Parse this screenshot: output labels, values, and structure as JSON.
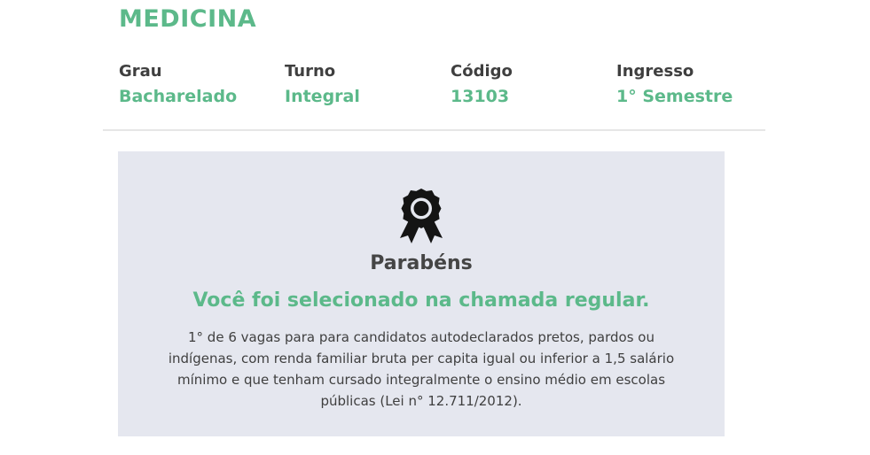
{
  "course": {
    "title": "MEDICINA"
  },
  "info": [
    {
      "label": "Grau",
      "value": "Bacharelado"
    },
    {
      "label": "Turno",
      "value": "Integral"
    },
    {
      "label": "Código",
      "value": "13103"
    },
    {
      "label": "Ingresso",
      "value": "1° Semestre"
    }
  ],
  "result": {
    "icon": "award-ribbon-icon",
    "heading": "Parabéns",
    "status": "Você foi selecionado na chamada regular.",
    "description": "1° de 6 vagas para para candidatos autodeclarados pretos, pardos ou indígenas, com renda familiar bruta per capita igual ou inferior a 1,5 salário mínimo e que tenham cursado integralmente o ensino médio em escolas públicas (Lei n° 12.711/2012)."
  },
  "colors": {
    "accent": "#5cb98a",
    "text": "#3f3f3f",
    "card_bg": "#e5e7ef"
  }
}
